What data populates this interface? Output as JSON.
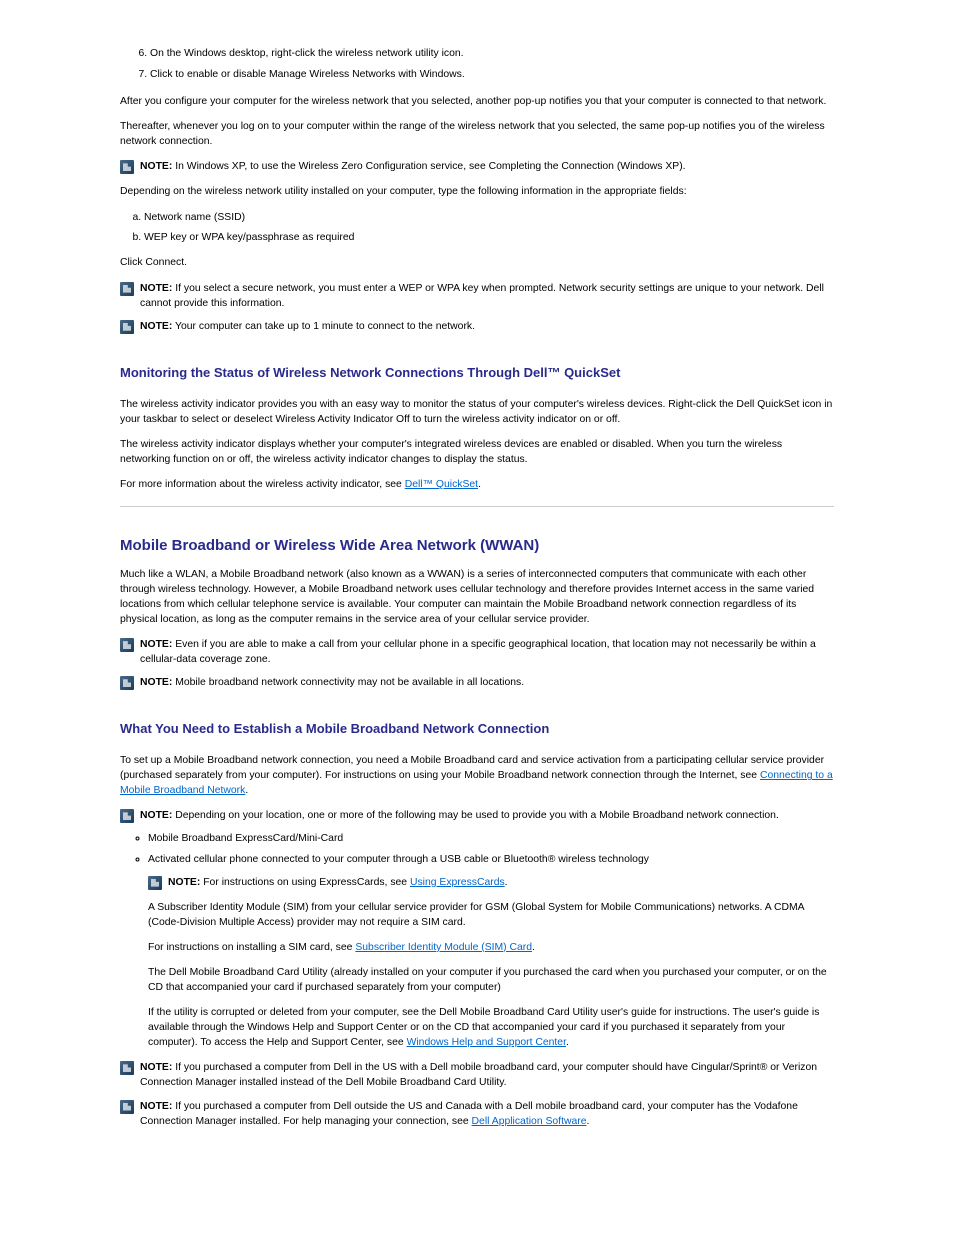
{
  "intro_steps": [
    "On the Windows desktop, right-click the wireless network utility icon.",
    "Click to enable or disable Manage Wireless Networks with Windows."
  ],
  "p_afterconfig": "After you configure your computer for the wireless network that you selected, another pop-up notifies you that your computer is connected to that network.",
  "p_thereafter": "Thereafter, whenever you log on to your computer within the range of the wireless network that you selected, the same pop-up notifies you of the wireless network connection.",
  "note_xp_wzc_label": "NOTE:",
  "note_xp_wzc_text": " In Windows XP, to use the Wireless Zero Configuration service, see Completing the Connection (Windows XP).",
  "p_field_intro": "Depending on the wireless network utility installed on your computer, type the following information in the appropriate fields:",
  "field_items": [
    "Network name (SSID)",
    "WEP key or WPA key/passphrase as required"
  ],
  "p_click_connect": "Click Connect.",
  "note_secure_label": "NOTE:",
  "note_secure_text": " If you select a secure network, you must enter a WEP or WPA key when prompted. Network security settings are unique to your network. Dell cannot provide this information.",
  "note_wait_label": "NOTE:",
  "note_wait_text": " Your computer can take up to 1 minute to connect to the network.",
  "h_monitor": "Monitoring the Status of Wireless Network Connections Through Dell™ QuickSet",
  "p_monitor1": "The wireless activity indicator provides you with an easy way to monitor the status of your computer's wireless devices. Right-click the Dell QuickSet icon in your taskbar to select or deselect Wireless Activity Indicator Off to turn the wireless activity indicator on or off.",
  "p_monitor2": "The wireless activity indicator displays whether your computer's integrated wireless devices are enabled or disabled. When you turn the wireless networking function on or off, the wireless activity indicator changes to display the status.",
  "p_monitor3_prefix": "For more information about the wireless activity indicator, see ",
  "link_quickset": "Dell™ QuickSet",
  "p_monitor3_suffix": ".",
  "h_mbn": "Mobile Broadband or Wireless Wide Area Network (WWAN)",
  "p_mbn_intro": "Much like a WLAN, a Mobile Broadband network (also known as a WWAN) is a series of interconnected computers that communicate with each other through wireless technology. However, a Mobile Broadband network uses cellular technology and therefore provides Internet access in the same varied locations from which cellular telephone service is available. Your computer can maintain the Mobile Broadband network connection regardless of its physical location, as long as the computer remains in the service area of your cellular service provider.",
  "note_phone_label": "NOTE:",
  "note_phone_text": " Even if you are able to make a call from your cellular phone in a specific geographical location, that location may not necessarily be within a cellular-data coverage zone.",
  "note_avail_label": "NOTE:",
  "note_avail_text": " Mobile broadband network connectivity may not be available in all locations.",
  "h_establish": "What You Need to Establish a Mobile Broadband Network Connection",
  "p_establish_intro_prefix": "To set up a Mobile Broadband network connection, you need a Mobile Broadband card and service activation from a participating cellular service provider (purchased separately from your computer). For instructions on using your Mobile Broadband network connection through the Internet, see ",
  "link_connecting": "Connecting to a Mobile Broadband Network",
  "p_establish_intro_suffix": ".",
  "note_loc_label": "NOTE:",
  "note_loc_text": " Depending on your location, one or more of the following may be used to provide you with a Mobile Broadband network connection.",
  "bullets": [
    "Mobile Broadband ExpressCard/Mini-Card",
    "Activated cellular phone connected to your computer through a USB cable or Bluetooth® wireless technology"
  ],
  "note_express_label": "NOTE:",
  "note_express_text_prefix": " For instructions on using ExpressCards, see ",
  "link_expresscards": "Using ExpressCards",
  "note_express_text_suffix": ".",
  "p_sim": "A Subscriber Identity Module (SIM) from your cellular service provider for GSM (Global System for Mobile Communications) networks. A CDMA (Code-Division Multiple Access) provider may not require a SIM card.",
  "p_sim2_prefix": "For instructions on installing a SIM card, see ",
  "link_sim": "Subscriber Identity Module (SIM) Card",
  "p_sim2_suffix": ".",
  "p_utility": "The Dell Mobile Broadband Card Utility (already installed on your computer if you purchased the card when you purchased your computer, or on the CD that accompanied your card if purchased separately from your computer)",
  "p_reinstall": "If the utility is corrupted or deleted from your computer, see the Dell Mobile Broadband Card Utility user's guide for instructions. The user's guide is available through the Windows Help and Support Center or on the CD that accompanied your card if you purchased it separately from your computer). To access the Help and Support Center, see ",
  "link_help": "Windows Help and Support Center",
  "p_reinstall_suffix": ".",
  "note_sprint_label": "NOTE:",
  "note_sprint_text": " If you purchased a computer from Dell in the US with a Dell mobile broadband card, your computer should have Cingular/Sprint® or Verizon Connection Manager installed instead of the Dell Mobile Broadband Card Utility.",
  "note_das_label": "NOTE:",
  "note_das_prefix": " If you purchased a computer from Dell outside the US and Canada with a Dell mobile broadband card, your computer has the Vodafone Connection Manager installed. For help managing your connection, see ",
  "link_das": "Dell Application Software",
  "note_das_suffix": "."
}
